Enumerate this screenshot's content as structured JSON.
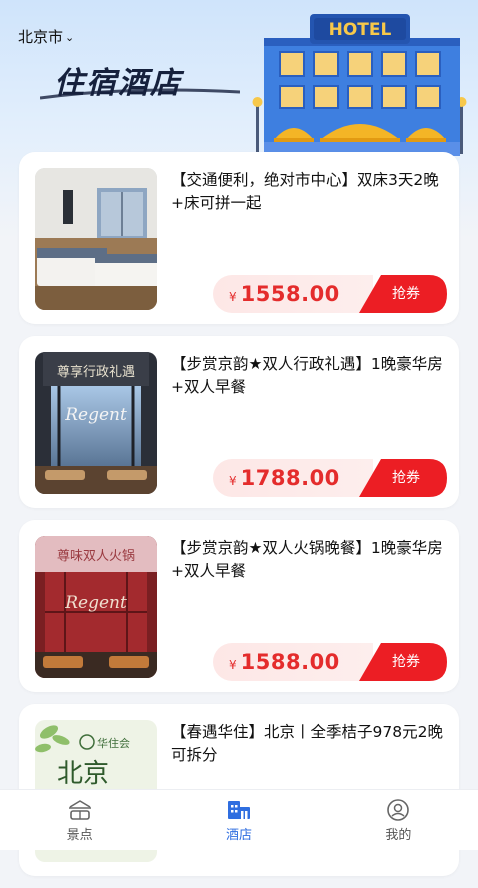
{
  "header": {
    "city": "北京市",
    "hero_title": "住宿酒店",
    "hotel_sign": "HOTEL"
  },
  "cards": [
    {
      "title": "【交通便利，绝对市中心】双床3天2晚+床可拼一起",
      "currency": "¥",
      "price": "1558.00",
      "button": "抢券"
    },
    {
      "title": "【步赏京韵★双人行政礼遇】1晚豪华房+双人早餐",
      "currency": "¥",
      "price": "1788.00",
      "button": "抢券",
      "image_caption": "尊享行政礼遇",
      "image_logo": "Regent"
    },
    {
      "title": "【步赏京韵★双人火锅晚餐】1晚豪华房+双人早餐",
      "currency": "¥",
      "price": "1588.00",
      "button": "抢券",
      "image_caption": "尊味双人火锅",
      "image_logo": "Regent"
    },
    {
      "title": "【春遇华住】北京丨全季桔子978元2晚可拆分",
      "image_caption": "北京",
      "image_logo": "华住会"
    }
  ],
  "tabbar": {
    "items": [
      {
        "label": "景点",
        "icon": "scenic-icon"
      },
      {
        "label": "酒店",
        "icon": "hotel-icon",
        "active": true
      },
      {
        "label": "我的",
        "icon": "profile-icon"
      }
    ]
  },
  "colors": {
    "accent": "#2f6ee0",
    "price": "#e42c2c",
    "button": "#ec1e24"
  }
}
